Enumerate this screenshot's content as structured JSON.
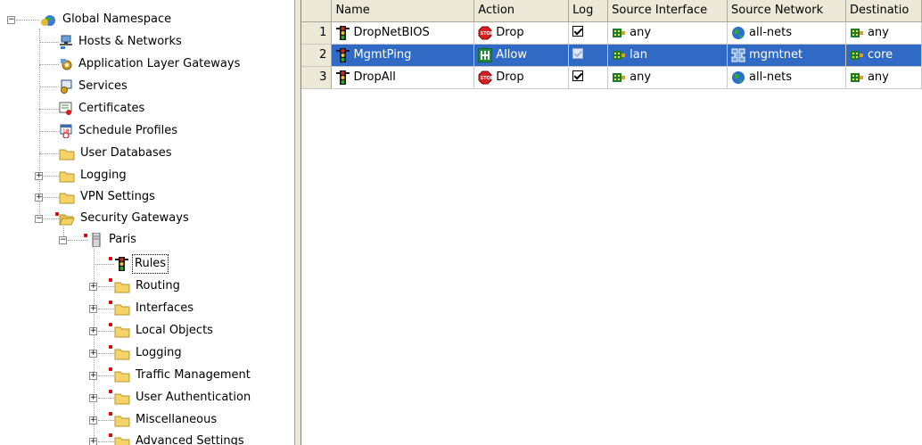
{
  "tree": {
    "root": "Global Namespace",
    "items": [
      "Hosts & Networks",
      "Application Layer Gateways",
      "Services",
      "Certificates",
      "Schedule Profiles",
      "User Databases",
      "Logging",
      "VPN Settings",
      "Security Gateways"
    ],
    "gateway": "Paris",
    "gateway_items": [
      "Rules",
      "Routing",
      "Interfaces",
      "Local Objects",
      "Logging",
      "Traffic Management",
      "User Authentication",
      "Miscellaneous",
      "Advanced Settings"
    ],
    "selected": "Rules"
  },
  "grid": {
    "columns": [
      "Name",
      "Action",
      "Log",
      "Source Interface",
      "Source Network",
      "Destinatio"
    ],
    "rows": [
      {
        "num": "1",
        "name": "DropNetBIOS",
        "action": "Drop",
        "action_icon": "stop-icon",
        "log": true,
        "src_if": "any",
        "src_net": "all-nets",
        "src_net_icon": "globe-icon",
        "dest": "any"
      },
      {
        "num": "2",
        "name": "MgmtPing",
        "action": "Allow",
        "action_icon": "allow-icon",
        "log": true,
        "src_if": "lan",
        "src_net": "mgmtnet",
        "src_net_icon": "network-icon",
        "dest": "core",
        "selected": true
      },
      {
        "num": "3",
        "name": "DropAll",
        "action": "Drop",
        "action_icon": "stop-icon",
        "log": true,
        "src_if": "any",
        "src_net": "all-nets",
        "src_net_icon": "globe-icon",
        "dest": "any"
      }
    ]
  },
  "colors": {
    "selection": "#316ac5",
    "header_bg": "#ece9d8",
    "folder": "#f5d36a",
    "stop_red": "#d81e1e",
    "allow_green": "#1f8a3a"
  }
}
